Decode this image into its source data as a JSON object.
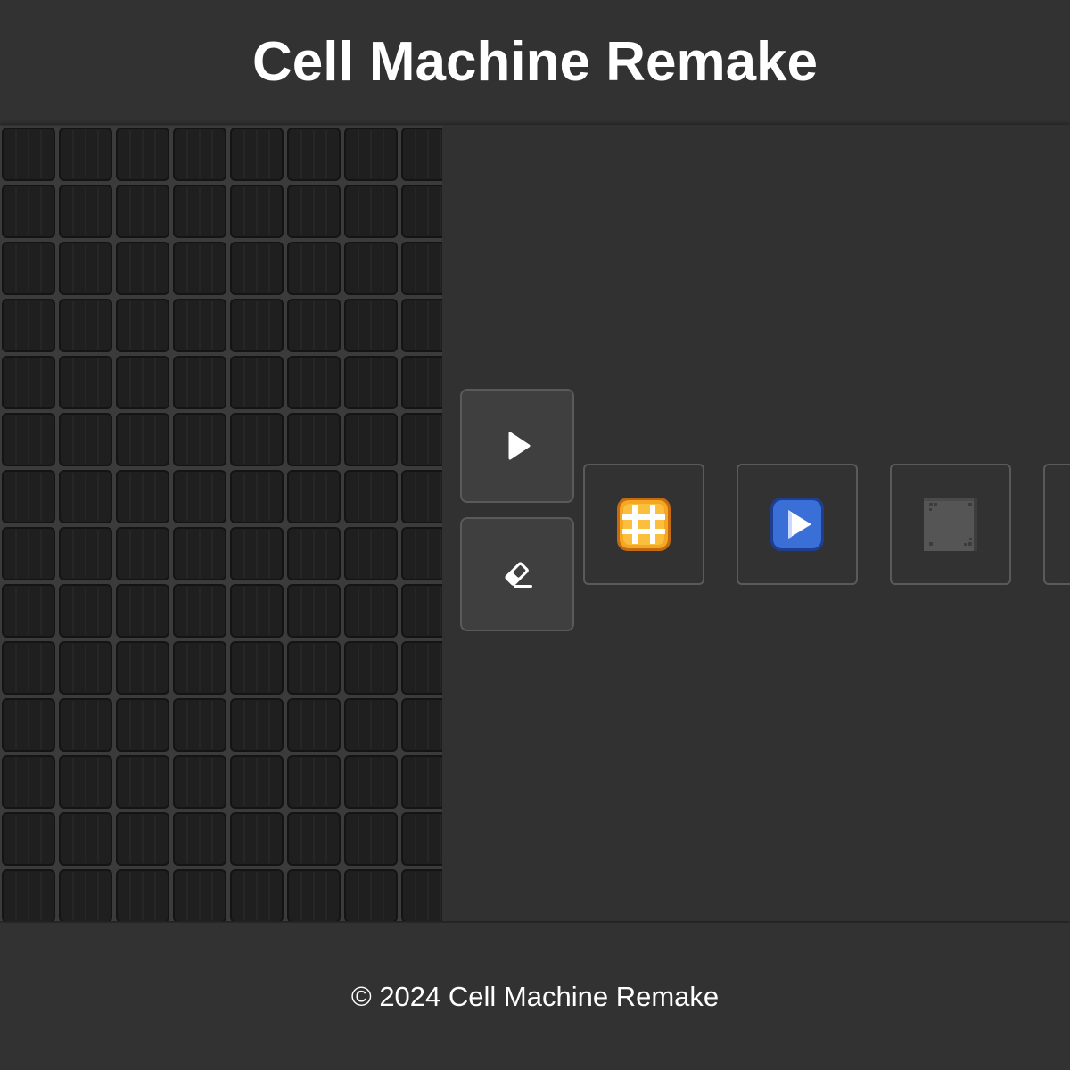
{
  "header": {
    "title": "Cell Machine Remake"
  },
  "controls": {
    "play_icon": "play-icon",
    "eraser_icon": "eraser-icon"
  },
  "palette": {
    "cells": [
      {
        "name": "generator-cell",
        "icon": "hash-icon",
        "color": "#f5a623"
      },
      {
        "name": "mover-cell",
        "icon": "arrow-right-icon",
        "color": "#3a6fd8"
      },
      {
        "name": "immobile-cell",
        "icon": "square-icon",
        "color": "#555555"
      },
      {
        "name": "next-cell",
        "icon": "cell-icon",
        "color": "#555555"
      }
    ]
  },
  "colors": {
    "background": "#323232",
    "grid_cell": "#2a2a2a",
    "grid_line": "#4a4a4a",
    "button_bg": "#3f3f3f",
    "button_border": "#5a5a5a"
  },
  "footer": {
    "text": "© 2024 Cell Machine Remake"
  }
}
